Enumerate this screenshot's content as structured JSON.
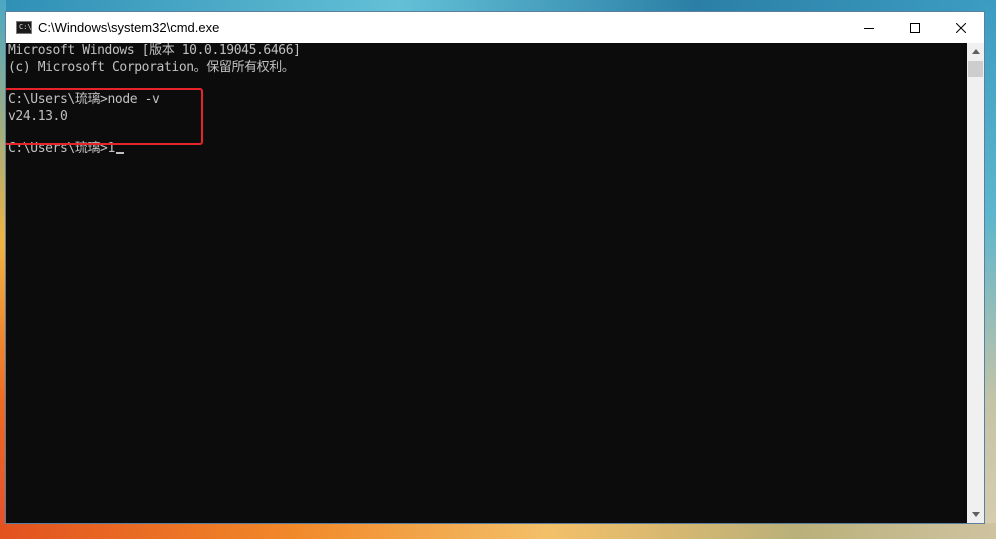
{
  "window": {
    "title": "C:\\Windows\\system32\\cmd.exe",
    "icon": "cmd-console-icon",
    "icon_glyph": "C:\\"
  },
  "controls": {
    "minimize_icon": "minimize-icon",
    "maximize_icon": "maximize-icon",
    "close_icon": "close-icon"
  },
  "console": {
    "lines": [
      "Microsoft Windows [版本 10.0.19045.6466]",
      "(c) Microsoft Corporation。保留所有权利。",
      "C:\\Users\\琉璃>node -v",
      "v24.13.0",
      "C:\\Users\\琉璃>1"
    ],
    "text_color": "#c0c0c0",
    "background_color": "#0c0c0c"
  },
  "annotation": {
    "highlight_color": "#e8242a"
  },
  "scrollbar": {
    "up_icon": "scroll-up-arrow-icon",
    "down_icon": "scroll-down-arrow-icon"
  }
}
